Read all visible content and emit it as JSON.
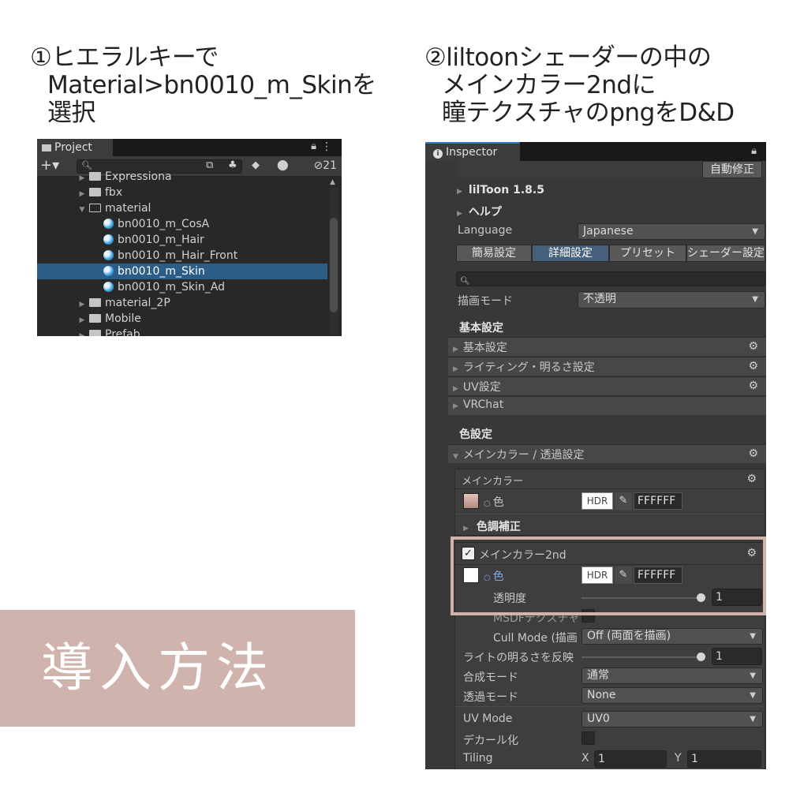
{
  "instructions": {
    "step1": [
      "①ヒエラルキーで",
      "Material>bn0010_m_Skinを",
      "選択"
    ],
    "step2": [
      "②liltoonシェーダーの中の",
      "メインカラー2ndに",
      "瞳テクスチャのpngをD&D"
    ]
  },
  "badge": "導入方法",
  "project": {
    "tab": "Project",
    "count": "21",
    "items": [
      {
        "label": "Expressiona",
        "type": "folder",
        "depth": 1
      },
      {
        "label": "fbx",
        "type": "folder",
        "depth": 1
      },
      {
        "label": "material",
        "type": "folder-open",
        "depth": 1
      },
      {
        "label": "bn0010_m_CosA",
        "type": "material",
        "depth": 2
      },
      {
        "label": "bn0010_m_Hair",
        "type": "material",
        "depth": 2
      },
      {
        "label": "bn0010_m_Hair_Front",
        "type": "material",
        "depth": 2
      },
      {
        "label": "bn0010_m_Skin",
        "type": "material",
        "depth": 2,
        "selected": true
      },
      {
        "label": "bn0010_m_Skin_Ad",
        "type": "material",
        "depth": 2
      },
      {
        "label": "material_2P",
        "type": "folder",
        "depth": 1
      },
      {
        "label": "Mobile",
        "type": "folder",
        "depth": 1
      },
      {
        "label": "Prefab",
        "type": "folder",
        "depth": 1
      }
    ]
  },
  "inspector": {
    "tab": "Inspector",
    "auto_fix": "自動修正",
    "liltoon_version": "lilToon 1.8.5",
    "help": "ヘルプ",
    "language_label": "Language",
    "language_value": "Japanese",
    "tabs": [
      "簡易設定",
      "詳細設定",
      "プリセット",
      "シェーダー設定"
    ],
    "render_mode_label": "描画モード",
    "render_mode_value": "不透明",
    "basic_header": "基本設定",
    "sections": [
      "基本設定",
      "ライティング・明るさ設定",
      "UV設定",
      "VRChat"
    ],
    "color_header": "色設定",
    "main_color_section": "メインカラー / 透過設定",
    "main_color_label": "メインカラー",
    "color_label": "色",
    "hdr": "HDR",
    "hex_main": "FFFFFF",
    "tone_correction": "色調補正",
    "main_color_2nd": "メインカラー2nd",
    "hex_2nd": "FFFFFF",
    "opacity_label": "透明度",
    "opacity_value": "1",
    "msdf_label": "MSDFテクスチャ",
    "cull_mode_label": "Cull Mode (描画",
    "cull_mode_value": "Off (両面を描画)",
    "light_label": "ライトの明るさを反映",
    "light_value": "1",
    "blend_label": "合成モード",
    "blend_value": "通常",
    "alpha_label": "透過モード",
    "alpha_value": "None",
    "uv_mode_label": "UV Mode",
    "uv_mode_value": "UV0",
    "decal_label": "デカール化",
    "tiling_label": "Tiling",
    "tiling_x": "1",
    "tiling_y": "1",
    "x": "X",
    "y": "Y"
  },
  "colors": {
    "badge": "#cfb3ac",
    "selection": "#2c5d87",
    "active_tab": "#46607c"
  }
}
